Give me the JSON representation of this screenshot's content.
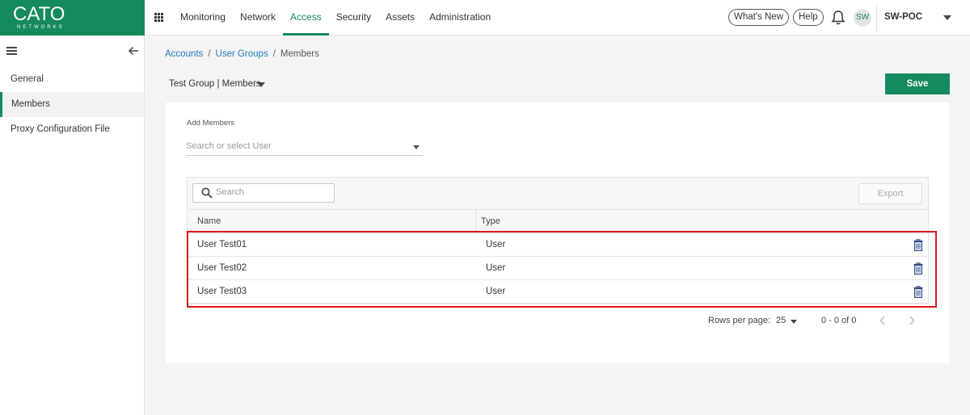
{
  "brand": {
    "name": "CATO",
    "sub": "NETWORKS",
    "color": "#158a5c"
  },
  "nav": {
    "items": [
      {
        "label": "Monitoring",
        "active": false
      },
      {
        "label": "Network",
        "active": false
      },
      {
        "label": "Access",
        "active": true
      },
      {
        "label": "Security",
        "active": false
      },
      {
        "label": "Assets",
        "active": false
      },
      {
        "label": "Administration",
        "active": false
      }
    ],
    "whats_new": "What's New",
    "help": "Help",
    "avatar": "SW",
    "account": "SW-POC"
  },
  "sidebar": {
    "items": [
      {
        "label": "General",
        "active": false
      },
      {
        "label": "Members",
        "active": true
      },
      {
        "label": "Proxy Configuration File",
        "active": false
      }
    ]
  },
  "breadcrumb": {
    "accounts": "Accounts",
    "user_groups": "User Groups",
    "current": "Members"
  },
  "page": {
    "group_title": "Test Group | Members",
    "save_label": "Save"
  },
  "add_members": {
    "label": "Add Members",
    "placeholder": "Search or select User"
  },
  "table": {
    "search_placeholder": "Search",
    "export_label": "Export",
    "columns": [
      "Name",
      "Type"
    ],
    "rows": [
      {
        "name": "User Test01",
        "type": "User"
      },
      {
        "name": "User Test02",
        "type": "User"
      },
      {
        "name": "User Test03",
        "type": "User"
      }
    ]
  },
  "pagination": {
    "rows_per_page_label": "Rows per page:",
    "rows_per_page": "25",
    "range": "0 - 0 of 0"
  },
  "icons": [
    "apps-grid-icon",
    "bell-icon",
    "hamburger-icon",
    "back-arrow-icon",
    "search-icon",
    "trash-icon",
    "chevron-left-icon",
    "chevron-right-icon"
  ]
}
